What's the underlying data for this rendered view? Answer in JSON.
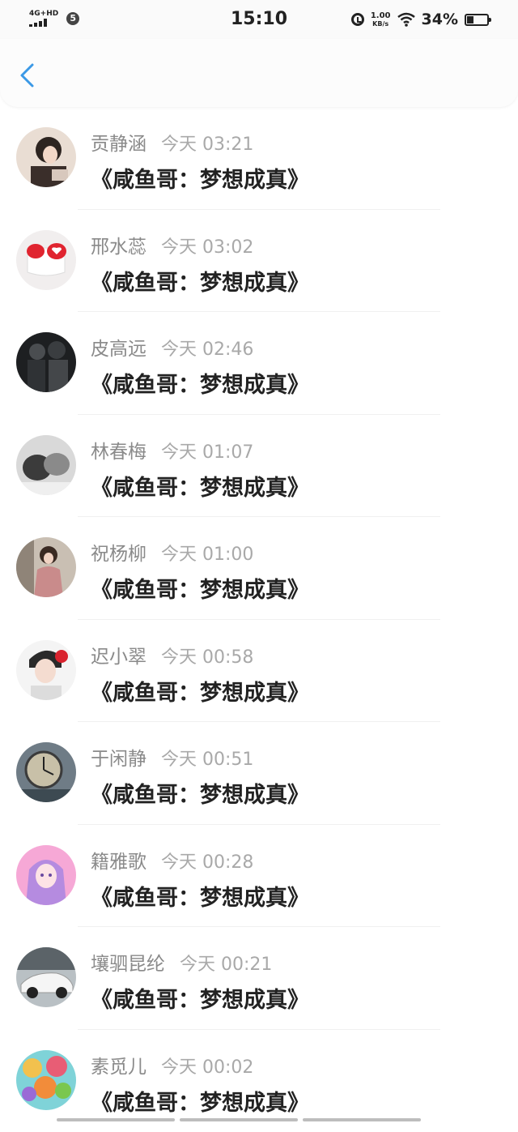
{
  "status_bar": {
    "network_label": "4G+HD",
    "sim_badge": "5",
    "time": "15:10",
    "speed_value": "1.00",
    "speed_unit": "KB/s",
    "battery_percent": "34%",
    "battery_level": 0.34
  },
  "nav": {
    "back_icon": "chevron-left-icon",
    "accent_color": "#3b99e6"
  },
  "messages": [
    {
      "sender": "贡静涵",
      "time": "今天 03:21",
      "text": "《咸鱼哥：梦想成真》"
    },
    {
      "sender": "邢水蕊",
      "time": "今天 03:02",
      "text": "《咸鱼哥：梦想成真》"
    },
    {
      "sender": "皮高远",
      "time": "今天 02:46",
      "text": "《咸鱼哥：梦想成真》"
    },
    {
      "sender": "林春梅",
      "time": "今天 01:07",
      "text": "《咸鱼哥：梦想成真》"
    },
    {
      "sender": "祝杨柳",
      "time": "今天 01:00",
      "text": "《咸鱼哥：梦想成真》"
    },
    {
      "sender": "迟小翠",
      "time": "今天 00:58",
      "text": "《咸鱼哥：梦想成真》"
    },
    {
      "sender": "于闲静",
      "time": "今天 00:51",
      "text": "《咸鱼哥：梦想成真》"
    },
    {
      "sender": "籍雅歌",
      "time": "今天 00:28",
      "text": "《咸鱼哥：梦想成真》"
    },
    {
      "sender": "壤驷昆纶",
      "time": "今天 00:21",
      "text": "《咸鱼哥：梦想成真》"
    },
    {
      "sender": "素觅儿",
      "time": "今天 00:02",
      "text": "《咸鱼哥：梦想成真》"
    }
  ]
}
